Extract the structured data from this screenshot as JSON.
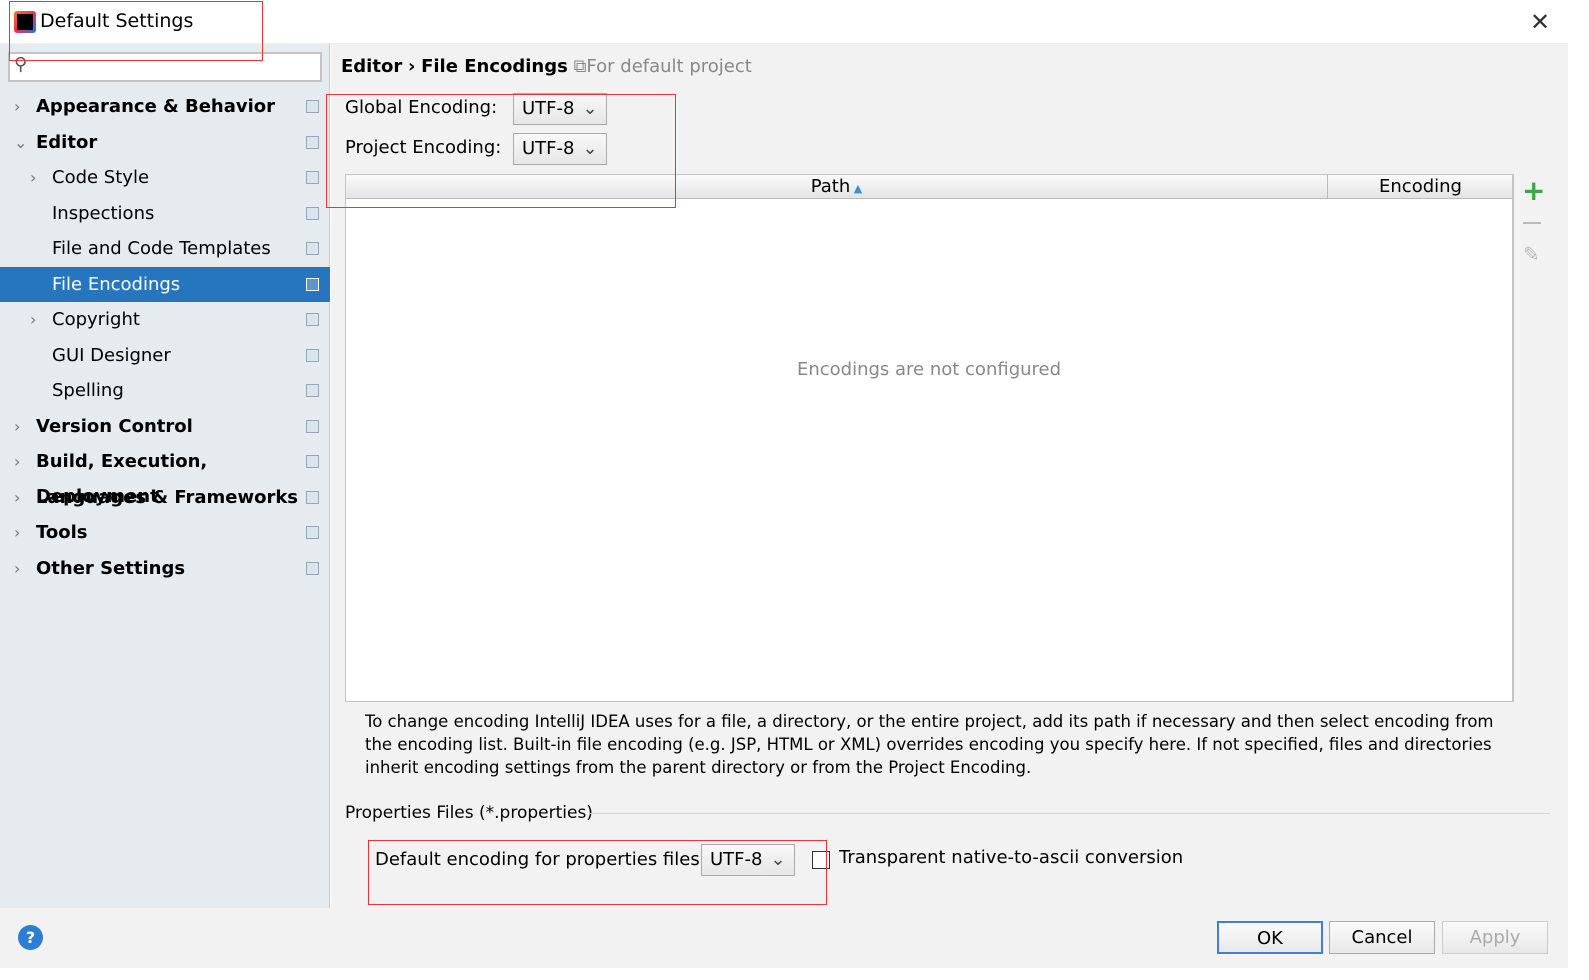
{
  "window": {
    "title": "Default Settings",
    "close_icon": "close-icon"
  },
  "search": {
    "placeholder": ""
  },
  "sidebar": {
    "items": [
      {
        "label": "Appearance & Behavior",
        "bold": true,
        "expander": "collapsed",
        "level": 0
      },
      {
        "label": "Editor",
        "bold": true,
        "expander": "expanded",
        "level": 0
      },
      {
        "label": "Code Style",
        "bold": false,
        "expander": "collapsed",
        "level": 1
      },
      {
        "label": "Inspections",
        "bold": false,
        "expander": "none",
        "level": 1
      },
      {
        "label": "File and Code Templates",
        "bold": false,
        "expander": "none",
        "level": 1
      },
      {
        "label": "File Encodings",
        "bold": false,
        "expander": "none",
        "level": 1,
        "selected": true
      },
      {
        "label": "Copyright",
        "bold": false,
        "expander": "collapsed",
        "level": 1
      },
      {
        "label": "GUI Designer",
        "bold": false,
        "expander": "none",
        "level": 1
      },
      {
        "label": "Spelling",
        "bold": false,
        "expander": "none",
        "level": 1
      },
      {
        "label": "Version Control",
        "bold": true,
        "expander": "collapsed",
        "level": 0
      },
      {
        "label": "Build, Execution, Deployment",
        "bold": true,
        "expander": "collapsed",
        "level": 0
      },
      {
        "label": "Languages & Frameworks",
        "bold": true,
        "expander": "collapsed",
        "level": 0
      },
      {
        "label": "Tools",
        "bold": true,
        "expander": "collapsed",
        "level": 0
      },
      {
        "label": "Other Settings",
        "bold": true,
        "expander": "collapsed",
        "level": 0
      }
    ]
  },
  "breadcrumb": {
    "parent": "Editor",
    "sep": "›",
    "current": "File Encodings",
    "scope": "For default project"
  },
  "global_encoding": {
    "label": "Global Encoding:",
    "value": "UTF-8"
  },
  "project_encoding": {
    "label": "Project Encoding:",
    "value": "UTF-8"
  },
  "table": {
    "columns": [
      "Path",
      "Encoding"
    ],
    "sort": "Path ascending",
    "empty_text": "Encodings are not configured"
  },
  "description": "To change encoding IntelliJ IDEA uses for a file, a directory, or the entire project, add its path if necessary and then select encoding from the encoding list. Built-in file encoding (e.g. JSP, HTML or XML) overrides encoding you specify here. If not specified, files and directories inherit encoding settings from the parent directory or from the Project Encoding.",
  "properties": {
    "section": "Properties Files (*.properties)",
    "label": "Default encoding for properties files:",
    "value": "UTF-8",
    "checkbox_label": "Transparent native-to-ascii conversion",
    "checked": false
  },
  "buttons": {
    "ok": "OK",
    "cancel": "Cancel",
    "apply": "Apply",
    "help": "?"
  },
  "colors": {
    "selection": "#2675bf",
    "add": "#3aa845",
    "annotation": "#e33333"
  }
}
